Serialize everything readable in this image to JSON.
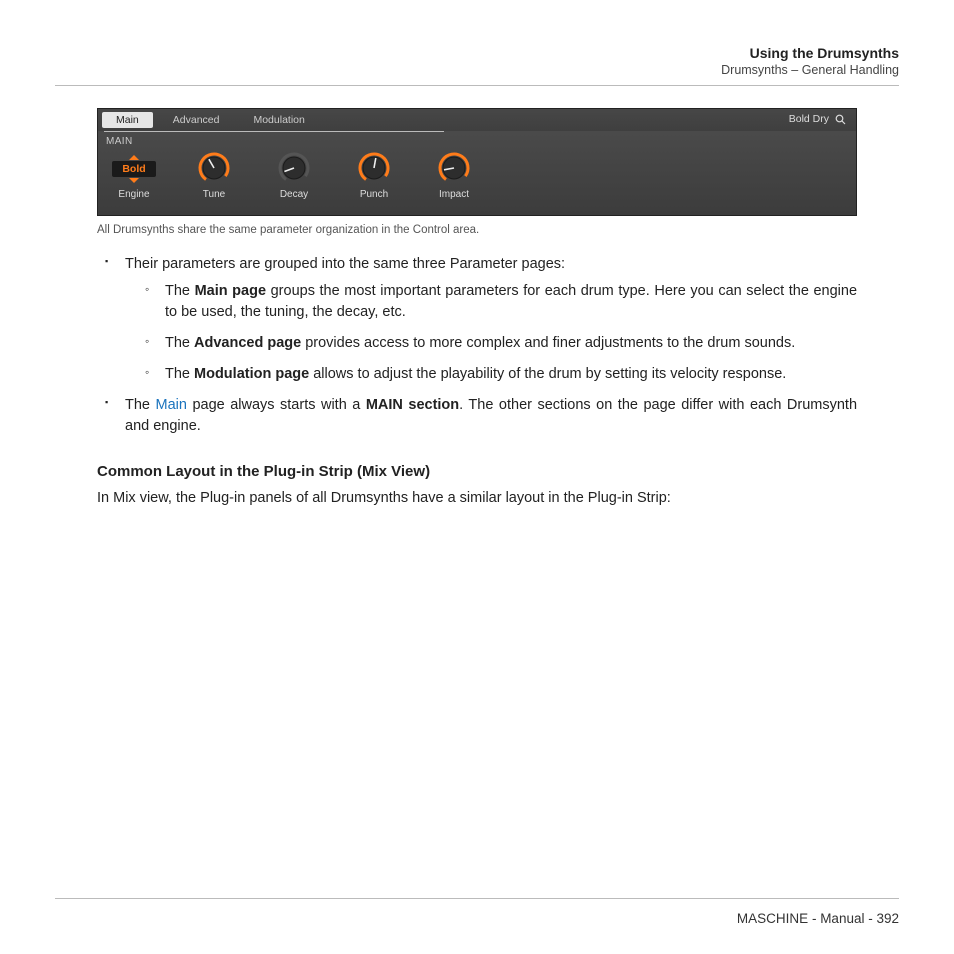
{
  "header": {
    "title": "Using the Drumsynths",
    "subtitle": "Drumsynths – General Handling"
  },
  "control_area": {
    "tabs": [
      "Main",
      "Advanced",
      "Modulation"
    ],
    "active_tab_index": 0,
    "preset_name": "Bold Dry",
    "section_label": "MAIN",
    "engine_value": "Bold",
    "columns": [
      {
        "label": "Engine",
        "type": "selector"
      },
      {
        "label": "Tune",
        "type": "knob",
        "angle": -30,
        "accent": true
      },
      {
        "label": "Decay",
        "type": "knob",
        "angle": -110,
        "accent": false
      },
      {
        "label": "Punch",
        "type": "knob",
        "angle": 10,
        "accent": true
      },
      {
        "label": "Impact",
        "type": "knob",
        "angle": -100,
        "accent": true
      }
    ]
  },
  "figure_caption": "All Drumsynths share the same parameter organization in the Control area.",
  "bullets": {
    "intro": "Their parameters are grouped into the same three Parameter pages:",
    "items": [
      {
        "prefix": "The ",
        "bold": "Main page",
        "rest": " groups the most important parameters for each drum type. Here you can select the engine to be used, the tuning, the decay, etc."
      },
      {
        "prefix": "The ",
        "bold": "Advanced page",
        "rest": " provides access to more complex and finer adjustments to the drum sounds."
      },
      {
        "prefix": "The ",
        "bold": "Modulation page",
        "rest": " allows to adjust the playability of the drum by setting its velocity response."
      }
    ],
    "second_prefix": "The ",
    "second_link": "Main",
    "second_mid": " page always starts with a ",
    "second_bold": "MAIN section",
    "second_rest": ". The other sections on the page differ with each Drumsynth and engine."
  },
  "subheading": "Common Layout in the Plug-in Strip (Mix View)",
  "body_line": "In Mix view, the Plug-in panels of all Drumsynths have a similar layout in the Plug-in Strip:",
  "footer": {
    "product": "MASCHINE",
    "doc": "Manual",
    "page": "392"
  }
}
